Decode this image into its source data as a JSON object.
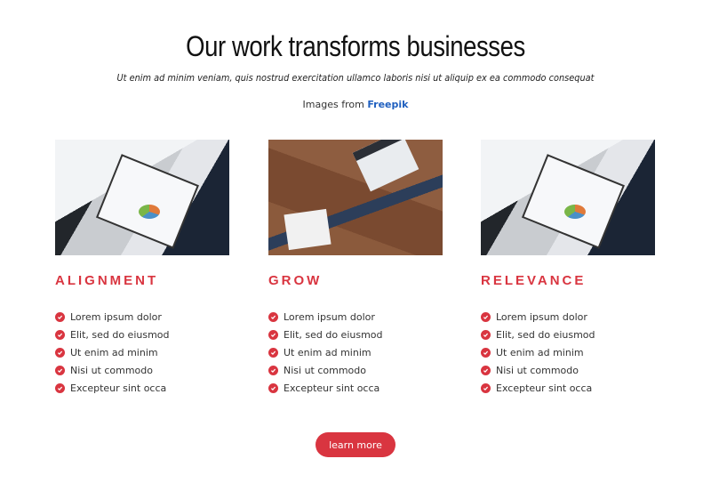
{
  "header": {
    "title": "Our work transforms businesses",
    "subtitle": "Ut enim ad minim veniam, quis nostrud exercitation ullamco laboris nisi ut aliquip ex ea commodo consequat",
    "credits_prefix": "Images from",
    "credits_link": "Freepik"
  },
  "colors": {
    "accent": "#d93540",
    "link": "#1f5fbf"
  },
  "columns": [
    {
      "heading": "ALIGNMENT",
      "image": "business-documents-photo",
      "items": [
        "Lorem ipsum dolor",
        "Elit, sed do eiusmod",
        "Ut enim ad minim",
        "Nisi ut commodo",
        "Excepteur sint occa"
      ]
    },
    {
      "heading": "GROW",
      "image": "handshake-desk-photo",
      "items": [
        "Lorem ipsum dolor",
        "Elit, sed do eiusmod",
        "Ut enim ad minim",
        "Nisi ut commodo",
        "Excepteur sint occa"
      ]
    },
    {
      "heading": "RELEVANCE",
      "image": "business-documents-photo",
      "items": [
        "Lorem ipsum dolor",
        "Elit, sed do eiusmod",
        "Ut enim ad minim",
        "Nisi ut commodo",
        "Excepteur sint occa"
      ]
    }
  ],
  "cta": {
    "label": "learn more"
  }
}
